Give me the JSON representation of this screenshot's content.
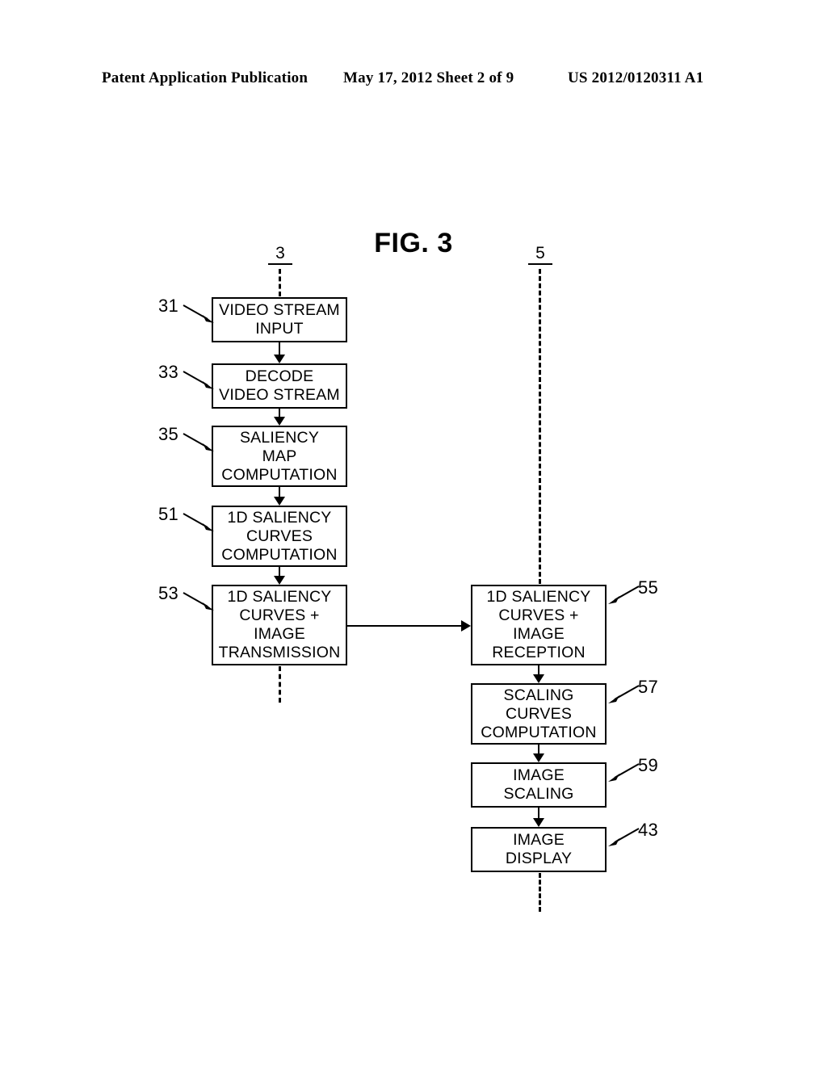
{
  "header": {
    "left": "Patent Application Publication",
    "middle": "May 17, 2012  Sheet 2 of 9",
    "right": "US 2012/0120311 A1"
  },
  "figure": {
    "title": "FIG. 3",
    "columns": [
      {
        "id": "transmitter",
        "ref": "3"
      },
      {
        "id": "receiver",
        "ref": "5"
      }
    ]
  },
  "left_column": {
    "ref": "3",
    "boxes": [
      {
        "ref": "31",
        "lines": [
          "VIDEO STREAM",
          "INPUT"
        ]
      },
      {
        "ref": "33",
        "lines": [
          "DECODE",
          "VIDEO STREAM"
        ]
      },
      {
        "ref": "35",
        "lines": [
          "SALIENCY",
          "MAP",
          "COMPUTATION"
        ]
      },
      {
        "ref": "51",
        "lines": [
          "1D SALIENCY",
          "CURVES",
          "COMPUTATION"
        ]
      },
      {
        "ref": "53",
        "lines": [
          "1D SALIENCY",
          "CURVES +",
          "IMAGE",
          "TRANSMISSION"
        ]
      }
    ]
  },
  "right_column": {
    "ref": "5",
    "boxes": [
      {
        "ref": "55",
        "lines": [
          "1D SALIENCY",
          "CURVES +",
          "IMAGE",
          "RECEPTION"
        ]
      },
      {
        "ref": "57",
        "lines": [
          "SCALING",
          "CURVES",
          "COMPUTATION"
        ]
      },
      {
        "ref": "59",
        "lines": [
          "IMAGE",
          "SCALING"
        ]
      },
      {
        "ref": "43",
        "lines": [
          "IMAGE",
          "DISPLAY"
        ]
      }
    ]
  },
  "colors": {
    "ink": "#000000",
    "paper": "#ffffff"
  }
}
